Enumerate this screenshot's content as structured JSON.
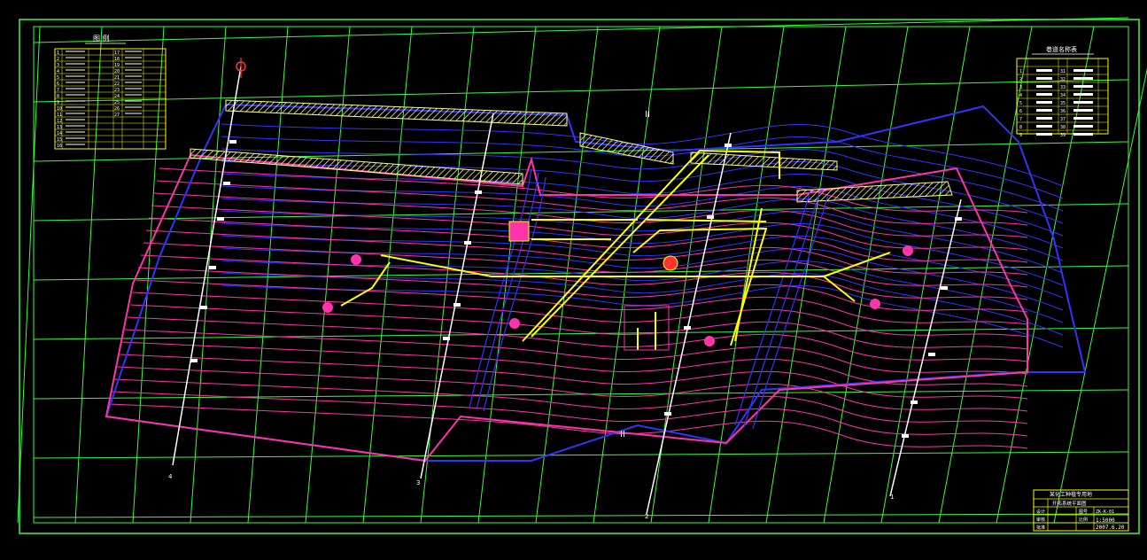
{
  "legend": {
    "title": "图  例",
    "numbers": [
      "1",
      "2",
      "3",
      "4",
      "5",
      "6",
      "7",
      "8",
      "9",
      "10",
      "11",
      "12",
      "13",
      "14",
      "15",
      "16"
    ],
    "numbers_right": [
      "17",
      "18",
      "19",
      "20",
      "21",
      "22",
      "23",
      "24",
      "25",
      "26",
      "27"
    ]
  },
  "shaft_table": {
    "title": "巷道名称表",
    "numbers": [
      "1",
      "2",
      "3",
      "4",
      "5",
      "6",
      "7",
      "8",
      "9"
    ],
    "numbers_right": [
      "31",
      "32",
      "33",
      "34",
      "35",
      "36",
      "37",
      "38",
      "39"
    ]
  },
  "section_labels": [
    "4",
    "3",
    "2",
    "1"
  ],
  "annotations": {
    "section_mark_top": "II",
    "section_mark_bottom": "II"
  },
  "title_block": {
    "company": "某化工种植专用地",
    "drawing_name": "开拓系统平面图",
    "labels": [
      "设计",
      "审核",
      "批准"
    ],
    "scale_label": "比例",
    "scale": "1:5000",
    "drawing_no_label": "图号",
    "drawing_no": "ZK-K-01",
    "date": "2007.6.20"
  },
  "colors": {
    "background": "#000000",
    "grid": "#33ff33",
    "contour_blue": "#3333ff",
    "contour_magenta": "#ff33aa",
    "tunnel_yellow": "#ffff00",
    "hatch": "#ffff88",
    "boundary": "#33ff33"
  }
}
